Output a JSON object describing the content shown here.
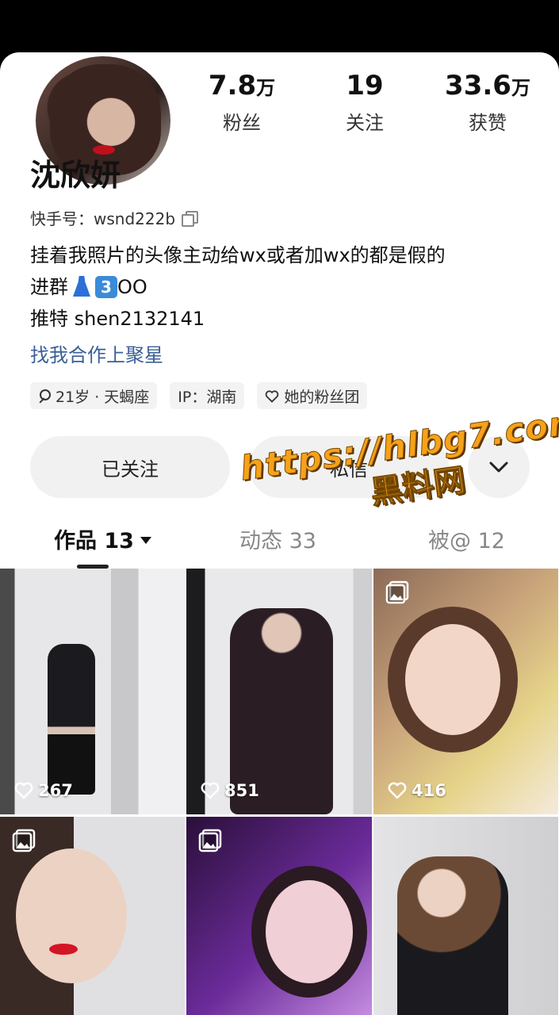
{
  "profile": {
    "name": "沈欣妍",
    "kuaishou_id_label": "快手号：wsnd222b",
    "bio_line1": "挂着我照片的头像主动给wx或者加wx的都是假的",
    "bio_line2_text": "进群",
    "bio_line2_keycap": "3",
    "bio_line2_suffix": "OO",
    "bio_line3": "推特 shen2132141",
    "cooperation_link": "找我合作上聚星"
  },
  "stats": [
    {
      "num": "7.8",
      "unit": "万",
      "label": "粉丝"
    },
    {
      "num": "19",
      "unit": "",
      "label": "关注"
    },
    {
      "num": "33.6",
      "unit": "万",
      "label": "获赞"
    }
  ],
  "tags": {
    "age": "21岁 · 天蝎座",
    "ip": "IP：湖南",
    "fan_group": "她的粉丝团"
  },
  "actions": {
    "follow": "已关注",
    "message": "私信"
  },
  "watermark": {
    "url": "https://hlbg7.com",
    "name": "黑料网"
  },
  "tabs": [
    {
      "label": "作品 13"
    },
    {
      "label": "动态 33"
    },
    {
      "label": "被@ 12"
    }
  ],
  "posts": [
    {
      "likes": "267"
    },
    {
      "likes": "851"
    },
    {
      "likes": "416"
    }
  ],
  "colors": {
    "link": "#3a5f98",
    "watermark": "#f6a21a"
  }
}
